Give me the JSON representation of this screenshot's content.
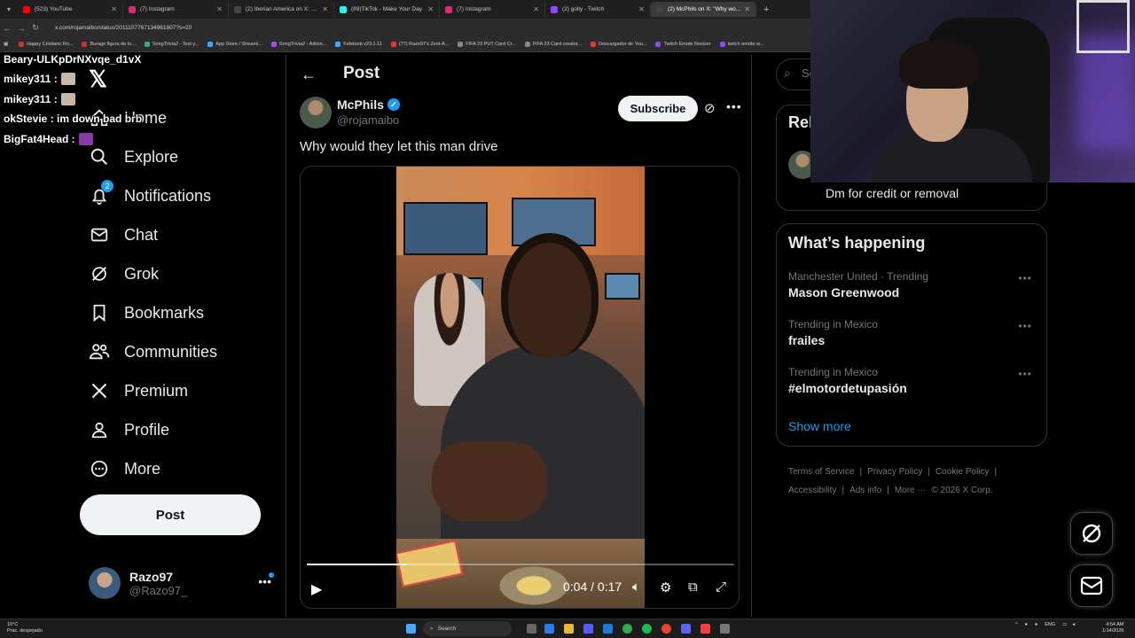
{
  "browser": {
    "tabs": [
      {
        "title": "(523) YouTube",
        "color": "#ff0000",
        "active": false
      },
      {
        "title": "(7) Instagram",
        "color": "#d62976",
        "active": false
      },
      {
        "title": "(2) Iberian America on X: \"Tho...",
        "color": "#444444",
        "active": false
      },
      {
        "title": "(89)TikTok - Make Your Day",
        "color": "#25f4ee",
        "active": false
      },
      {
        "title": "(7) Instagram",
        "color": "#d62976",
        "active": false
      },
      {
        "title": "(2) golly - Twitch",
        "color": "#9146ff",
        "active": false
      },
      {
        "title": "(2) McPhils on X: \"Why wo...",
        "color": "#444444",
        "active": true
      }
    ],
    "url": "x.com/rojamaibo/status/2011107767134961807?s=20",
    "bookmarks": [
      {
        "label": "Happy Cristiano Ro...",
        "color": "#c33"
      },
      {
        "label": "Burago figura de to...",
        "color": "#c33"
      },
      {
        "label": "SongTrivia2 - Test y...",
        "color": "#3a8"
      },
      {
        "label": "App Store / Streami...",
        "color": "#4af"
      },
      {
        "label": "SongTrivia2 - Adivin...",
        "color": "#a4f"
      },
      {
        "label": "Feletoob v23.1.11",
        "color": "#4af"
      },
      {
        "label": "(77) Razo97's Zest-A...",
        "color": "#e33"
      },
      {
        "label": "FIFA 23 PUT Card Cr...",
        "color": "#888"
      },
      {
        "label": "FIFA 23 Card creator...",
        "color": "#888"
      },
      {
        "label": "Descargador de You...",
        "color": "#e33"
      },
      {
        "label": "Twitch Emote Resizer",
        "color": "#9146ff"
      },
      {
        "label": "twitch emote w...",
        "color": "#9146ff"
      }
    ]
  },
  "stream_chat": [
    {
      "text": "Beary-ULKpDrNXvqe_d1vX",
      "emote": ""
    },
    {
      "text": "mikey311 :",
      "emote": "#c8b8a8"
    },
    {
      "text": "mikey311 :",
      "emote": "#c8b8a8"
    },
    {
      "text": "okStevie : im down bad brb",
      "emote": ""
    },
    {
      "text": "BigFat4Head :",
      "emote": "#8a3aa8"
    }
  ],
  "nav": {
    "items": [
      {
        "label": "Home",
        "icon": "home-icon"
      },
      {
        "label": "Explore",
        "icon": "search-icon"
      },
      {
        "label": "Notifications",
        "icon": "bell-icon",
        "badge": "2"
      },
      {
        "label": "Chat",
        "icon": "mail-icon"
      },
      {
        "label": "Grok",
        "icon": "grok-icon"
      },
      {
        "label": "Bookmarks",
        "icon": "bookmark-icon"
      },
      {
        "label": "Communities",
        "icon": "communities-icon"
      },
      {
        "label": "Premium",
        "icon": "x-icon"
      },
      {
        "label": "Profile",
        "icon": "profile-icon"
      },
      {
        "label": "More",
        "icon": "more-circle-icon"
      }
    ],
    "post_button": "Post",
    "account": {
      "name": "Razo97",
      "handle": "@Razo97_"
    }
  },
  "main": {
    "header_title": "Post",
    "author": {
      "name": "McPhils",
      "handle": "@rojamaibo"
    },
    "subscribe_label": "Subscribe",
    "text": "Why would they let this man drive",
    "video": {
      "time": "0:04 / 0:17",
      "progress": 0.235
    }
  },
  "sidebar": {
    "search_placeholder": "Se",
    "relevant_title": "Rel",
    "relevant_desc": "Dm for credit or removal",
    "happening_title": "What’s happening",
    "trends": [
      {
        "meta": "Manchester United · Trending",
        "name": "Mason Greenwood"
      },
      {
        "meta": "Trending in Mexico",
        "name": "frailes"
      },
      {
        "meta": "Trending in Mexico",
        "name": "#elmotordetupasión"
      }
    ],
    "show_more": "Show more",
    "footer": [
      "Terms of Service",
      "|",
      "Privacy Policy",
      "|",
      "Cookie Policy",
      "|",
      "Accessibility",
      "|",
      "Ads info",
      "|",
      "More ···",
      "© 2026 X Corp."
    ]
  },
  "taskbar": {
    "weather": [
      "10°C",
      "Prac. despejado"
    ],
    "search": "Search",
    "lang": "ENG",
    "clock": [
      "4:54 AM",
      "1/14/2026"
    ]
  }
}
